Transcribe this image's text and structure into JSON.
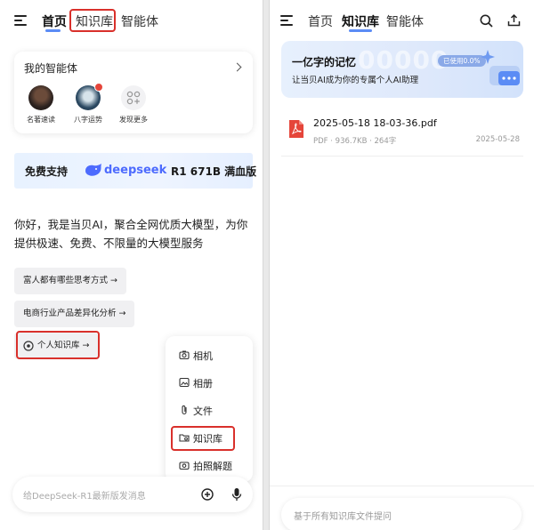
{
  "left": {
    "tabs": {
      "home": "首页",
      "knowledge": "知识库",
      "agents": "智能体"
    },
    "agent_card": {
      "title": "我的智能体",
      "agents": [
        {
          "label": "名著速读",
          "icon": "avatar-photo-icon"
        },
        {
          "label": "八字运势",
          "icon": "avatar-photo-icon"
        },
        {
          "label": "发现更多",
          "icon": "grid-plus-icon"
        }
      ]
    },
    "banner": {
      "prefix": "免费支持",
      "brand": "deepseek",
      "suffix": "R1 671B 满血版"
    },
    "intro": "你好，我是当贝AI，聚合全网优质大模型，为你提供极速、免费、不限量的大模型服务",
    "chips": {
      "think": "富人都有哪些思考方式 →",
      "analysis": "电商行业产品差异化分析 →",
      "knowledge": "个人知识库 →"
    },
    "attach_menu": {
      "camera": "相机",
      "album": "相册",
      "file": "文件",
      "knowledge": "知识库",
      "photo_solve": "拍照解题"
    },
    "input": {
      "placeholder": "给DeepSeek-R1最新版发消息"
    }
  },
  "right": {
    "tabs": {
      "home": "首页",
      "knowledge": "知识库",
      "agents": "智能体"
    },
    "promo": {
      "title": "一亿字的记忆",
      "subtitle": "让当贝AI成为你的专属个人AI助理",
      "badge": "已使用0.0%",
      "bg_digits": "00000"
    },
    "files": [
      {
        "name": "2025-05-18 18-03-36.pdf",
        "meta": "PDF · 936.7KB · 264字",
        "date": "2025-05-28"
      }
    ],
    "input": {
      "placeholder": "基于所有知识库文件提问"
    }
  },
  "colors": {
    "highlight": "#d9302b",
    "accent": "#5b8cf5",
    "pdf": "#e5453a",
    "deepseek": "#4d6bfe"
  }
}
